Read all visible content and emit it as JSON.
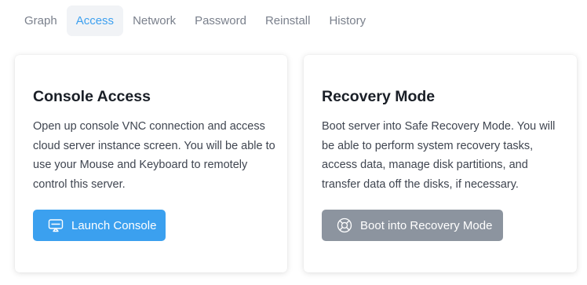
{
  "tabs": [
    {
      "label": "Graph"
    },
    {
      "label": "Access"
    },
    {
      "label": "Network"
    },
    {
      "label": "Password"
    },
    {
      "label": "Reinstall"
    },
    {
      "label": "History"
    }
  ],
  "active_tab": "Access",
  "console": {
    "title": "Console Access",
    "description": "Open up console VNC connection and access cloud server instance screen. You will be able to use your Mouse and Keyboard to remotely control this server.",
    "button_label": "Launch Console",
    "button_icon": "monitor-icon",
    "button_color": "#3ba0ef"
  },
  "recovery": {
    "title": "Recovery Mode",
    "description": "Boot server into Safe Recovery Mode. You will be able to perform system recovery tasks, access data, manage disk partitions, and transfer data off the disks, if necessary.",
    "button_label": "Boot into Recovery Mode",
    "button_icon": "lifebuoy-icon",
    "button_color": "#8c949f"
  }
}
